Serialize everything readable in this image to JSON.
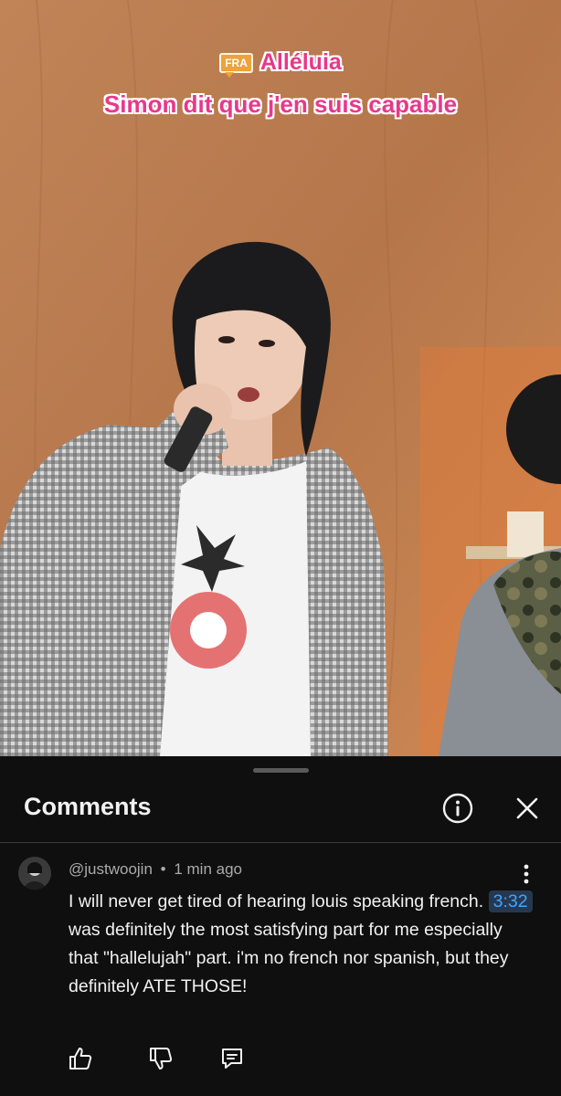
{
  "video": {
    "caption_language_badge": "FRA",
    "caption_title": "Alléluia",
    "caption_line": "Simon dit que j'en suis capable"
  },
  "comments_panel": {
    "title": "Comments",
    "info_icon": "info-icon",
    "close_icon": "close-icon"
  },
  "comment": {
    "author": "@justwoojin",
    "separator": "•",
    "time_ago": "1 min ago",
    "text_before": "I will never get tired of hearing louis speaking french. ",
    "timestamp": "3:32",
    "text_after": " was definitely the most satisfying part for me especially that \"hallelujah\" part. i'm no french nor spanish, but they definitely ATE THOSE!",
    "actions": {
      "like_icon": "thumbs-up-icon",
      "dislike_icon": "thumbs-down-icon",
      "reply_icon": "reply-icon"
    }
  },
  "colors": {
    "background": "#0f0f0f",
    "caption_pink": "#e8388a",
    "timestamp_blue": "#3ea6ff",
    "wall_wood": "#b97a4d"
  }
}
